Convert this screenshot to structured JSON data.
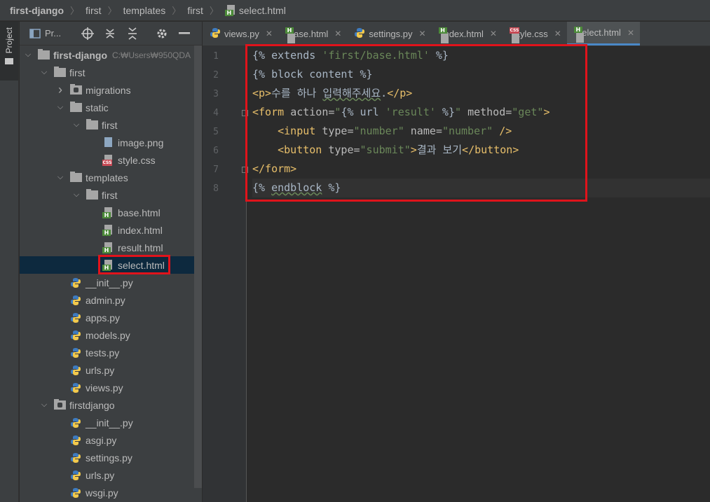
{
  "breadcrumb": {
    "items": [
      "first-django",
      "first",
      "templates",
      "first"
    ],
    "file": "select.html"
  },
  "toolstrip": {
    "project_label": "Project"
  },
  "project_panel": {
    "title": "Pr...",
    "root_hint": "C:₩Users₩950QDA"
  },
  "tree": [
    {
      "label": "first-django",
      "depth": 0,
      "kind": "folder",
      "expanded": true,
      "bold": true
    },
    {
      "label": "first",
      "depth": 1,
      "kind": "folder",
      "expanded": true
    },
    {
      "label": "migrations",
      "depth": 2,
      "kind": "module-folder",
      "expanded": false
    },
    {
      "label": "static",
      "depth": 2,
      "kind": "folder",
      "expanded": true
    },
    {
      "label": "first",
      "depth": 3,
      "kind": "folder",
      "expanded": true
    },
    {
      "label": "image.png",
      "depth": 4,
      "kind": "image"
    },
    {
      "label": "style.css",
      "depth": 4,
      "kind": "css"
    },
    {
      "label": "templates",
      "depth": 2,
      "kind": "folder",
      "expanded": true
    },
    {
      "label": "first",
      "depth": 3,
      "kind": "folder",
      "expanded": true
    },
    {
      "label": "base.html",
      "depth": 4,
      "kind": "html"
    },
    {
      "label": "index.html",
      "depth": 4,
      "kind": "html"
    },
    {
      "label": "result.html",
      "depth": 4,
      "kind": "html"
    },
    {
      "label": "select.html",
      "depth": 4,
      "kind": "html",
      "selected": true
    },
    {
      "label": "__init__.py",
      "depth": 2,
      "kind": "python"
    },
    {
      "label": "admin.py",
      "depth": 2,
      "kind": "python"
    },
    {
      "label": "apps.py",
      "depth": 2,
      "kind": "python"
    },
    {
      "label": "models.py",
      "depth": 2,
      "kind": "python"
    },
    {
      "label": "tests.py",
      "depth": 2,
      "kind": "python"
    },
    {
      "label": "urls.py",
      "depth": 2,
      "kind": "python"
    },
    {
      "label": "views.py",
      "depth": 2,
      "kind": "python"
    },
    {
      "label": "firstdjango",
      "depth": 1,
      "kind": "module-folder",
      "expanded": true
    },
    {
      "label": "__init__.py",
      "depth": 2,
      "kind": "python"
    },
    {
      "label": "asgi.py",
      "depth": 2,
      "kind": "python"
    },
    {
      "label": "settings.py",
      "depth": 2,
      "kind": "python"
    },
    {
      "label": "urls.py",
      "depth": 2,
      "kind": "python"
    },
    {
      "label": "wsgi.py",
      "depth": 2,
      "kind": "python"
    }
  ],
  "tabs": [
    {
      "label": "views.py",
      "kind": "python"
    },
    {
      "label": "base.html",
      "kind": "html"
    },
    {
      "label": "settings.py",
      "kind": "python"
    },
    {
      "label": "index.html",
      "kind": "html"
    },
    {
      "label": "style.css",
      "kind": "css"
    },
    {
      "label": "select.html",
      "kind": "html",
      "active": true
    }
  ],
  "code": {
    "line_numbers": [
      "1",
      "2",
      "3",
      "4",
      "5",
      "6",
      "7",
      "8"
    ],
    "lines": [
      [
        {
          "t": "{% extends ",
          "c": "tmpl"
        },
        {
          "t": "'first/base.html'",
          "c": "str"
        },
        {
          "t": " %}",
          "c": "tmpl"
        }
      ],
      [
        {
          "t": "{% block content %}",
          "c": "tmpl"
        }
      ],
      [
        {
          "t": "<p>",
          "c": "tag"
        },
        {
          "t": "수를 하나 ",
          "c": "tmpl"
        },
        {
          "t": "입력해주세요",
          "c": "tmpl squiggle"
        },
        {
          "t": ".",
          "c": "tmpl"
        },
        {
          "t": "</p>",
          "c": "tag"
        }
      ],
      [
        {
          "t": "<form ",
          "c": "tag"
        },
        {
          "t": "action=",
          "c": "attr"
        },
        {
          "t": "\"",
          "c": "str"
        },
        {
          "t": "{% url ",
          "c": "tmpl"
        },
        {
          "t": "'result'",
          "c": "str"
        },
        {
          "t": " %}",
          "c": "tmpl"
        },
        {
          "t": "\" ",
          "c": "str"
        },
        {
          "t": "method=",
          "c": "attr"
        },
        {
          "t": "\"get\"",
          "c": "str"
        },
        {
          "t": ">",
          "c": "tag"
        }
      ],
      [
        {
          "t": "    <input ",
          "c": "tag"
        },
        {
          "t": "type=",
          "c": "attr"
        },
        {
          "t": "\"number\" ",
          "c": "str"
        },
        {
          "t": "name=",
          "c": "attr"
        },
        {
          "t": "\"number\" ",
          "c": "str"
        },
        {
          "t": "/>",
          "c": "tag"
        }
      ],
      [
        {
          "t": "    <button ",
          "c": "tag"
        },
        {
          "t": "type=",
          "c": "attr"
        },
        {
          "t": "\"submit\"",
          "c": "str"
        },
        {
          "t": ">",
          "c": "tag"
        },
        {
          "t": "결과 보기",
          "c": "tmpl"
        },
        {
          "t": "</button>",
          "c": "tag"
        }
      ],
      [
        {
          "t": "</form>",
          "c": "tag"
        }
      ],
      [
        {
          "t": "{% ",
          "c": "tmpl"
        },
        {
          "t": "endblock",
          "c": "tmpl squiggle"
        },
        {
          "t": " %}",
          "c": "tmpl"
        }
      ]
    ]
  },
  "colors": {
    "highlight": "#e0131b",
    "html_badge": "#4c8a39",
    "css_badge": "#c74a55",
    "active_tab_underline": "#4a88c7",
    "python_blue": "#3e7bbf",
    "python_yellow": "#f2c94c"
  }
}
